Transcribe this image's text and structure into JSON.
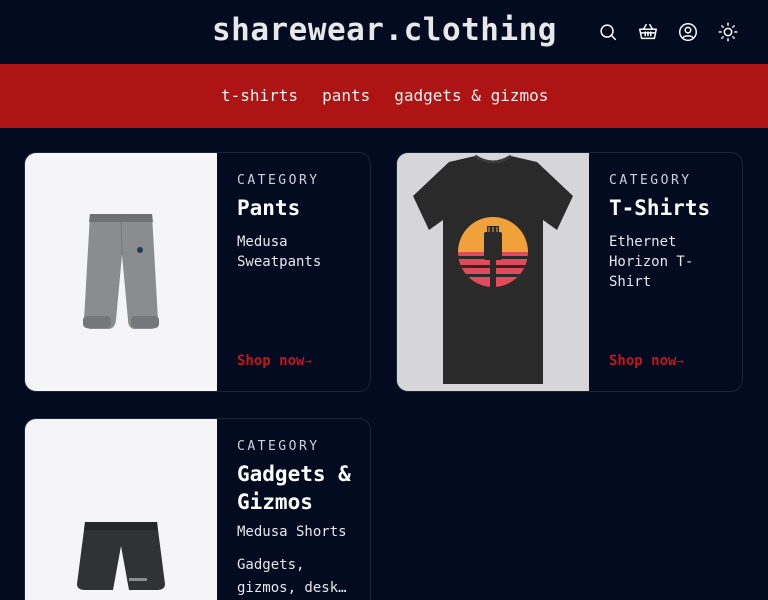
{
  "header": {
    "brand": "sharewear.clothing",
    "icons": [
      "search-icon",
      "basket-icon",
      "account-icon",
      "theme-toggle-icon"
    ]
  },
  "nav": {
    "links": [
      "t-shirts",
      "pants",
      "gadgets & gizmos"
    ]
  },
  "cards": [
    {
      "eyebrow": "CATEGORY",
      "title": "Pants",
      "product": "Medusa Sweatpants",
      "cta": "Shop now",
      "cta_arrow": "→"
    },
    {
      "eyebrow": "CATEGORY",
      "title": "T-Shirts",
      "product": "Ethernet Horizon T-Shirt",
      "cta": "Shop now",
      "cta_arrow": "→"
    },
    {
      "eyebrow": "CATEGORY",
      "title": "Gadgets & Gizmos",
      "product": "Medusa Shorts",
      "description": "Gadgets, gizmos, desk…"
    }
  ],
  "colors": {
    "background": "#020b1f",
    "nav": "#ae1414",
    "accent": "#c4151c"
  }
}
